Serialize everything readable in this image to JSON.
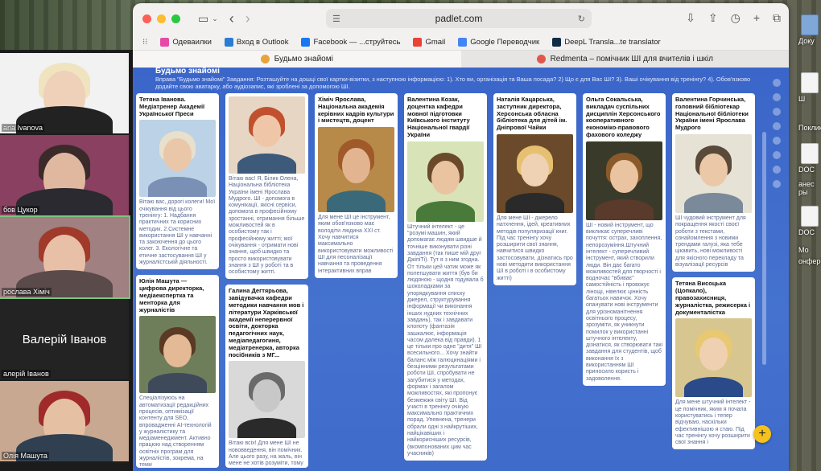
{
  "browser": {
    "url": "padlet.com",
    "bookmarks": [
      {
        "label": "Одеваилки",
        "color": "#e64aa8"
      },
      {
        "label": "Вход в Outlook",
        "color": "#2b7cd3"
      },
      {
        "label": "Facebook — ...струйтесь",
        "color": "#1877f2"
      },
      {
        "label": "Gmail",
        "color": "#ea4335"
      },
      {
        "label": "Google Переводчик",
        "color": "#4285f4"
      },
      {
        "label": "DeepL Transla...te translator",
        "color": "#0f2b46"
      }
    ],
    "tabs": [
      {
        "label": "Будьмо знайомі",
        "color": "#e8a43a",
        "active": true
      },
      {
        "label": "Redmenta – помічник ШІ для вчителів і шкіл",
        "color": "#e2574c",
        "active": false
      }
    ]
  },
  "padlet": {
    "title": "Будьмо знайомі",
    "description": "Вправа \"Будьмо знайомі\" Завдання: Розташуйте на дошці свої картки-візитки, з наступною інформацією: 1). Хто ви, організація та Ваша посада? 2) Що є для Вас ШІ? 3). Ваші очікування від тренінгу? 4). Обов'язково додайте свою аватарку, або аудіозапис, які зроблені за допомогою ШІ."
  },
  "columns": [
    [
      {
        "title": "Тетяна Іванова. Медіатренер Академії Української Преси",
        "body": "Вітаю вас, дорогі колеги! Мої очікування від цього тренінгу: 1. Надбання практичних та корисних методик. 2.Системне використання ШІ у навчанні та закоючення до цього колег. 3. Екологічне та етичне застосування ШІ у журналістській діяльності.",
        "img_h": 96,
        "palette": [
          "#bcd2e6",
          "#e9c7a8",
          "#e8e0cc",
          "#7a90b4"
        ]
      },
      {
        "title": "Юлія Машута — цифрова директорка, медіаекспертка та менторка для журналістів",
        "body": "Спеціалізуюсь на автоматизації редакційних процесів, оптимізації контенту для SEO, впровадженні AI-технологій у журналістику та медіаменеджмент. Активно працюю над створенням освітніх програм для журналістів, зокрема, на теми",
        "img_h": 96,
        "palette": [
          "#6e7e5a",
          "#e4b996",
          "#5a3a24",
          "#3e4a5a"
        ]
      }
    ],
    [
      {
        "title": "",
        "body": "Вітаю вас! Я, Білик Олена, Національна бібліотека України імені Ярослава Мудрого. ШІ - допомога в комунікації, якісні сервіси, допомога в професійному зростанні, отримання більше можливостей як в особистому так і професійному житті; мої очікування - отримати нові знання, щоб швидко та просто використовувати знання з ШІ у роботі та в особистому житті.",
        "img_h": 96,
        "palette": [
          "#e7d6c3",
          "#efc7a8",
          "#c0502e",
          "#3d5a7a"
        ]
      },
      {
        "title": "Галина Дегтярьова, завідувачка кафедри методики навчання мов і літератури Харківської академії неперервної освіти, докторка педагогічних наук, медіапедагогиня, медіатренерка, авторка посібників з МГ...",
        "body": "Вітаю всіх! Для мене ШІ не нововведення, він помічник. Але цього разу, на жаль, він мене не хотів розуміти, тому портрет не",
        "img_h": 96,
        "palette": [
          "#d9d9d9",
          "#c8c8c8",
          "#6a6a6a",
          "#2a2a2a"
        ]
      }
    ],
    [
      {
        "title": "Хіміч Ярослава, Національна академія керівних кадрів культури і мистецтв, доцент",
        "body": "Для мене ШІ це інструмент, яким обов'язково має володіти людина XXI ст. Хочу навчитися максимально використовувати можливості ШІ для песоналізації навчання та проведення інтерактивних вправ",
        "img_h": 106,
        "palette": [
          "#b88a4a",
          "#e2b590",
          "#a05a2a",
          "#3a6a7a"
        ]
      }
    ],
    [
      {
        "title": "Валентина Козак, доцентка кафедри мовної підготовки Київського інституту Національної гвардії України",
        "body": "Штучний інтелект - це \"розумі машин, який допомагає людям швидше й точніше виконувати різні завдання (так пише мій друг ДжіпіТі). Тут я з ним згодна. От тільки цей чатик може як полегшувати життя (був би людяною - щодня годувала б шоколадками за упорядкування списку джерел, структурування інформації чи виконання інших нудних технічних завдань), так і завдавати клопоту (фантазія зашкалює, інформація часом далека від правди). 1 це тільки про одне \"дитя\" ШІ всесильного... Хочу знайти баланс між галюцинаціями і безцінними результатами роботи ШІ, спробувати не загубитися у методах, формах і загалом можливостях, які пропонує безмежжя світу ШІ. Від участі в тренінгу очікую максимально практичних порад. Упевнена, тренери обрали одні з найкрутіших, найцікавіших і найкорисніших ресурсів, (вкомпонованих цим час учасників)",
        "img_h": 100,
        "palette": [
          "#d8e4b8",
          "#eac3a0",
          "#6a4a2a",
          "#4a7a3a"
        ]
      }
    ],
    [
      {
        "title": "Наталія Кацарська, заступник директора, Херсонська обласна бібліотека для дітей ім. Дніпрової Чайки",
        "body": "Для мене ШІ - джерело натхнення, ідей, креативних методів популяризації книг. Під час тренінгу хочу розширити свої знання, навчитися швидко застосовувати, дізнатись про нові методити використання ШІ в роботі і в особистому житті)",
        "img_h": 98,
        "palette": [
          "#6a4a2a",
          "#efd2b4",
          "#e6c070",
          "#2a2a2a"
        ]
      }
    ],
    [
      {
        "title": "Ольга Сокальська, викладач суспільних дисциплін Херсонського кооперативного економіко-правового фахового коледжу",
        "body": "ШІ - новий інструмент, що викликає суперечливі почуття: острах, захоплення, непорозуміння.Штучний інтелект - суперечливий інструмент, який створили люди. Він дає багато можливостей для творчості і водночас \"вбиває\" самостійність і провокує лінощі, нівелює цінність багатьох навичок. Хочу опанувати нові інструменти для урізноманітнення освітнього процесу, зрозуміти, як уникнути помилок у використанні штучного інтелекту, дізнатися, як створювати такі завдання для студентів, щоб виконання їх з використанням ШІ приносило користь і задоволення.",
        "img_h": 98,
        "palette": [
          "#3a3a2a",
          "#eac3a0",
          "#8a5a2a",
          "#5a3a2a"
        ]
      }
    ],
    [
      {
        "title": "Валентина Горчинська, головний бібліотекар Національної бібліотеки України імені Ярослава Мудрого",
        "body": "ШІ чудовий інструмент для покращення якості своєї роботи з текстами, ознайомлення з новими трендами галузі, яка тебе цікавить, нові можливості для якісного перекладу та візуалізації ресурсів",
        "img_h": 98,
        "palette": [
          "#e6e2d6",
          "#ebc9a8",
          "#5a4a3a",
          "#7a8a9a"
        ]
      },
      {
        "title": "Тетяна Висоцька (Цопкало), правозахисниця, журналістка, режисерка і документалістка",
        "body": "Для мене штучний інтелект - це помічник, яким я почала користуватись і тепер відчуваю, наскільки ефективнішою я стаю. Під час тренінгу хочу розширити свої знання і",
        "img_h": 98,
        "palette": [
          "#d8c690",
          "#efd0b0",
          "#e8c870",
          "#2a4a8a"
        ]
      }
    ]
  ],
  "participants": [
    {
      "name": "ana Ivanova",
      "palette": [
        "#f2f2f2",
        "#efd0b8",
        "#f0e3c0",
        "#222222"
      ],
      "active": false,
      "textonly": false
    },
    {
      "name": "бов Цукор",
      "palette": [
        "#8a4060",
        "#e0b8a0",
        "#3a2a2a",
        "#2a2a30"
      ],
      "active": false,
      "textonly": false
    },
    {
      "name": "рослава Хіміч",
      "palette": [
        "#a08080",
        "#e8c0a8",
        "#a03a2a",
        "#5a4a4a"
      ],
      "active": true,
      "textonly": false
    },
    {
      "name": "алерій Іванов",
      "big": "Валерій Іванов",
      "active": false,
      "textonly": true
    },
    {
      "name": "Олія Машута",
      "palette": [
        "#c8a890",
        "#e6c0a2",
        "#a02a2a",
        "#304050"
      ],
      "active": false,
      "textonly": false
    }
  ],
  "desktop": {
    "icons": [
      "Доку",
      "Ш",
      "Поклика",
      "DOC",
      "анес ры",
      "DOC",
      "Мо",
      "онферен"
    ]
  }
}
